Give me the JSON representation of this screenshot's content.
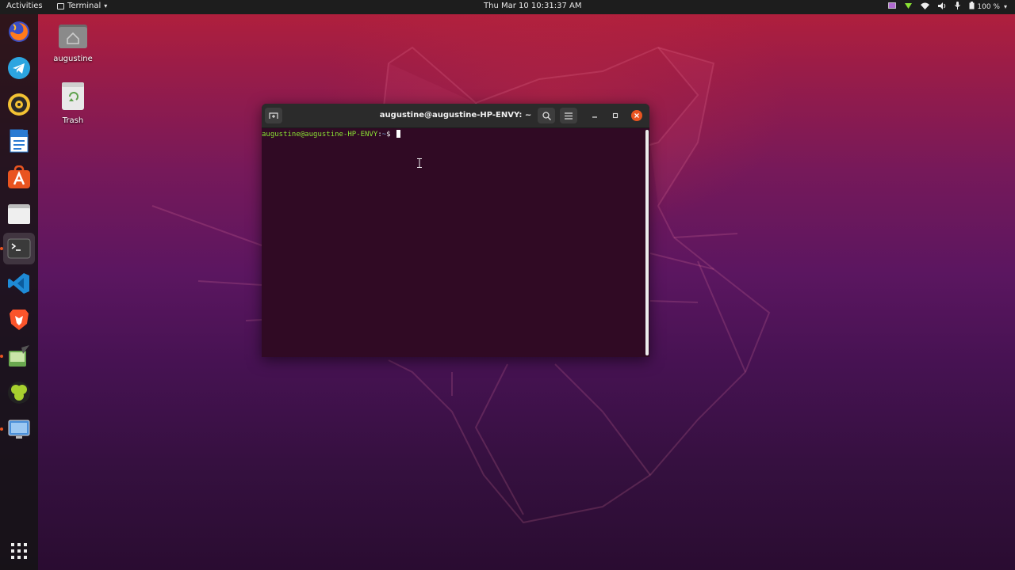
{
  "topbar": {
    "activities": "Activities",
    "app_menu": "Terminal",
    "clock": "Thu Mar 10  10:31:37 AM",
    "battery": "100 %",
    "tray_icons": [
      "screen-record-icon",
      "vpn-shield-icon",
      "wifi-icon",
      "volume-icon",
      "microphone-icon",
      "power-icon"
    ]
  },
  "dock": {
    "items": [
      "firefox",
      "telegram",
      "rhythmbox",
      "libreoffice-writer",
      "ubuntu-software",
      "files",
      "terminal",
      "vscode",
      "brave",
      "gimp",
      "gnome-tweaks",
      "screenshot-tool"
    ],
    "show_apps_icon": "app-grid-icon"
  },
  "desktop": {
    "home_label": "augustine",
    "trash_label": "Trash"
  },
  "terminal": {
    "title": "augustine@augustine-HP-ENVY: ~",
    "prompt_user": "augustine@augustine-HP-ENVY",
    "prompt_sep": ":",
    "prompt_path": "~",
    "prompt_symbol": "$ "
  },
  "colors": {
    "terminal_bg": "#300a24",
    "prompt_user": "#8ae234",
    "prompt_path": "#729fcf",
    "accent": "#e95420"
  }
}
